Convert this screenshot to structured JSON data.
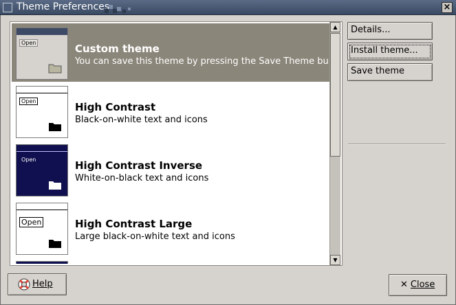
{
  "window": {
    "title": "Theme Preferences",
    "close_glyph": "×"
  },
  "themes": [
    {
      "name": "Custom theme",
      "description": "You can save this theme by pressing the Save Theme button",
      "thumb_open": "Open",
      "selected": true
    },
    {
      "name": "High Contrast",
      "description": "Black-on-white text and icons",
      "thumb_open": "Open",
      "selected": false
    },
    {
      "name": "High Contrast Inverse",
      "description": "White-on-black text and icons",
      "thumb_open": "Open",
      "selected": false
    },
    {
      "name": "High Contrast Large",
      "description": "Large black-on-white text and icons",
      "thumb_open": "Open",
      "selected": false
    }
  ],
  "actions": {
    "details": "Details...",
    "install_theme": "Install theme...",
    "save_theme": "Save theme"
  },
  "footer": {
    "help": "Help",
    "close": "Close"
  },
  "colors": {
    "selected_row": "#8b867a",
    "titlebar": "#4b5c78",
    "inverse_thumb": "#101050"
  },
  "icons": {
    "help": "lifebuoy-icon",
    "close": "x-icon",
    "scroll_up": "arrow-up-icon",
    "scroll_down": "arrow-down-icon",
    "folder": "folder-icon"
  }
}
